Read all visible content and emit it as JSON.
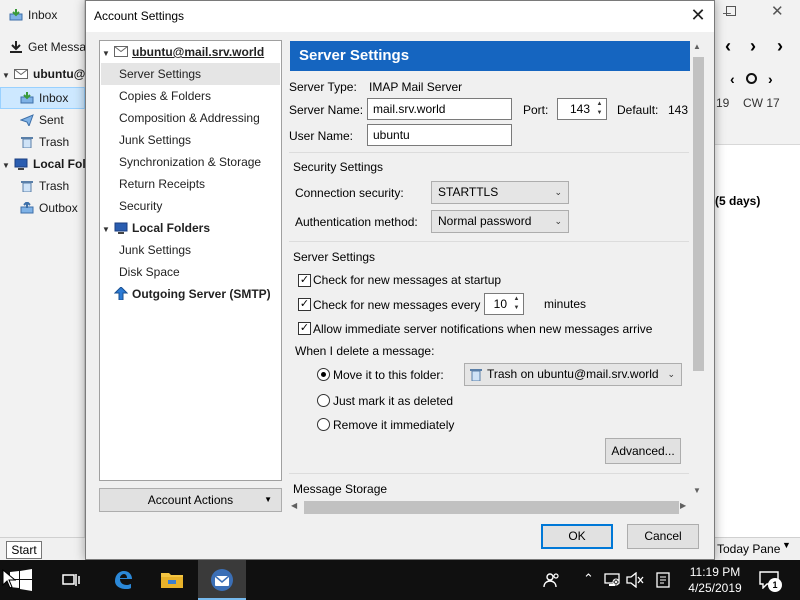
{
  "background": {
    "left_items": [
      {
        "label": "Inbox",
        "icon": "inbox-icon"
      },
      {
        "label": "Get Messages",
        "icon": "get-messages-icon"
      },
      {
        "label": "ubuntu@mail.srv.world",
        "icon": "mail-account-icon"
      },
      {
        "label": "Inbox",
        "icon": "inbox-icon"
      },
      {
        "label": "Sent",
        "icon": "sent-icon"
      },
      {
        "label": "Trash",
        "icon": "trash-icon"
      },
      {
        "label": "Local Folders",
        "icon": "local-folders-icon"
      },
      {
        "label": "Trash",
        "icon": "trash-icon"
      },
      {
        "label": "Outbox",
        "icon": "outbox-icon"
      }
    ],
    "calendar_nav": {
      "week_day": "19",
      "week_label": "CW 17"
    },
    "days_text": "(5 days)",
    "today_pane": "Today Pane"
  },
  "dialog": {
    "title": "Account Settings",
    "tree": [
      {
        "label": "ubuntu@mail.srv.world",
        "level": 0,
        "head": true
      },
      {
        "label": "Server Settings",
        "level": 1,
        "selected": true
      },
      {
        "label": "Copies & Folders",
        "level": 1
      },
      {
        "label": "Composition & Addressing",
        "level": 1
      },
      {
        "label": "Junk Settings",
        "level": 1
      },
      {
        "label": "Synchronization & Storage",
        "level": 1
      },
      {
        "label": "Return Receipts",
        "level": 1
      },
      {
        "label": "Security",
        "level": 1
      },
      {
        "label": "Local Folders",
        "level": 0,
        "head": true
      },
      {
        "label": "Junk Settings",
        "level": 1
      },
      {
        "label": "Disk Space",
        "level": 1
      },
      {
        "label": "Outgoing Server (SMTP)",
        "level": 0,
        "head": true
      }
    ],
    "account_actions": "Account Actions",
    "pane": {
      "header": "Server Settings",
      "server_type_label": "Server Type:",
      "server_type_value": "IMAP Mail Server",
      "server_name_label": "Server Name:",
      "server_name_value": "mail.srv.world",
      "port_label": "Port:",
      "port_value": "143",
      "default_label": "Default:",
      "default_value": "143",
      "user_name_label": "User Name:",
      "user_name_value": "ubuntu",
      "security_section": "Security Settings",
      "conn_security_label": "Connection security:",
      "conn_security_value": "STARTTLS",
      "auth_label": "Authentication method:",
      "auth_value": "Normal password",
      "server_section": "Server Settings",
      "check_startup": "Check for new messages at startup",
      "check_every": "Check for new messages every",
      "check_minutes_value": "10",
      "minutes": "minutes",
      "allow_notifications": "Allow immediate server notifications when new messages arrive",
      "delete_label": "When I delete a message:",
      "move_folder": "Move it to this folder:",
      "trash_folder": "Trash on ubuntu@mail.srv.world",
      "mark_deleted": "Just mark it as deleted",
      "remove_immediately": "Remove it immediately",
      "advanced": "Advanced...",
      "message_storage": "Message Storage"
    },
    "ok": "OK",
    "cancel": "Cancel"
  },
  "taskbar": {
    "start_tooltip": "Start",
    "time": "11:19 PM",
    "date": "4/25/2019",
    "notifications_count": "1"
  }
}
